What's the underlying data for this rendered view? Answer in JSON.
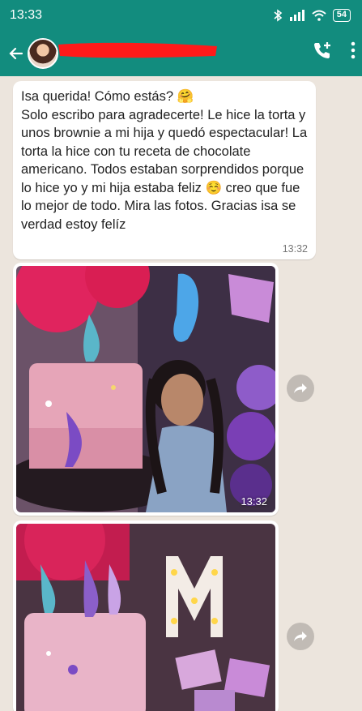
{
  "status_bar": {
    "time": "13:33",
    "battery": "54"
  },
  "chat": {
    "messages": [
      {
        "text": "Isa querida! Cómo estás? 🤗\nSolo escribo para agradecerte! Le hice la torta y unos brownie a mi hija y quedó espectacular! La torta la hice con tu receta de chocolate americano. Todos estaban sorprendidos porque lo hice yo y mi hija estaba feliz ☺️ creo que fue lo mejor de todo. Mira las fotos. Gracias isa se verdad estoy felíz",
        "time": "13:32"
      },
      {
        "time": "13:32"
      },
      {
        "time": ""
      }
    ]
  },
  "colors": {
    "header": "#128c7e",
    "chat_bg": "#ece5dd",
    "redaction": "#ff1a1a"
  },
  "icons": [
    "back-arrow-icon",
    "add-call-icon",
    "more-icon",
    "forward-icon"
  ]
}
